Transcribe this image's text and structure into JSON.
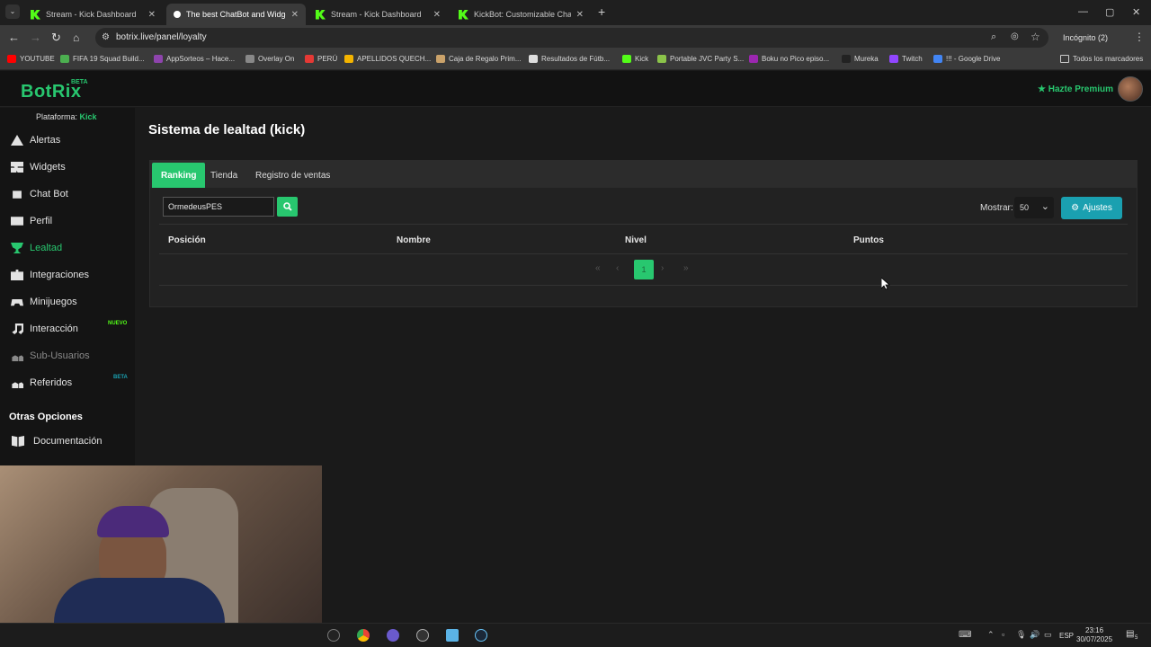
{
  "browser": {
    "tabs": [
      {
        "label": "Stream - Kick Dashboard",
        "active": false
      },
      {
        "label": "The best ChatBot and Widgets",
        "active": true
      },
      {
        "label": "Stream - Kick Dashboard",
        "active": false
      },
      {
        "label": "KickBot: Customizable Chat Bo",
        "active": false
      }
    ],
    "url": "botrix.live/panel/loyalty",
    "incognito_label": "Incógnito (2)",
    "bookmarks": [
      {
        "label": "YOUTUBE",
        "color": "#ff0000"
      },
      {
        "label": "FIFA 19 Squad Build...",
        "color": "#4caf50"
      },
      {
        "label": "AppSorteos – Hace...",
        "color": "#8e44ad"
      },
      {
        "label": "Overlay On",
        "color": "#888888"
      },
      {
        "label": "PERÚ",
        "color": "#e53935"
      },
      {
        "label": "APELLIDOS QUECH...",
        "color": "#f4b400"
      },
      {
        "label": "Caja de Regalo Prim...",
        "color": "#caa26a"
      },
      {
        "label": "Resultados de Fútb...",
        "color": "#dddddd"
      },
      {
        "label": "Kick",
        "color": "#53fc18"
      },
      {
        "label": "Portable JVC Party S...",
        "color": "#8bc34a"
      },
      {
        "label": "Boku no Pico episo...",
        "color": "#9c27b0"
      },
      {
        "label": "Mureka",
        "color": "#222222"
      },
      {
        "label": "Twitch",
        "color": "#9146ff"
      },
      {
        "label": "!!! - Google Drive",
        "color": "#4285f4"
      }
    ],
    "all_bookmarks_label": "Todos los marcadores"
  },
  "app": {
    "logo": "BotRix",
    "logo_badge": "BETA",
    "premium_label": "Hazte Premium",
    "accent": "#28c76f"
  },
  "sidebar": {
    "platform_label": "Plataforma:",
    "platform_value": "Kick",
    "items": [
      {
        "label": "Alertas",
        "icon": "warning-icon"
      },
      {
        "label": "Widgets",
        "icon": "grid-icon"
      },
      {
        "label": "Chat Bot",
        "icon": "robot-icon"
      },
      {
        "label": "Perfil",
        "icon": "id-card-icon"
      },
      {
        "label": "Lealtad",
        "icon": "trophy-icon"
      },
      {
        "label": "Integraciones",
        "icon": "puzzle-icon"
      },
      {
        "label": "Minijuegos",
        "icon": "gamepad-icon"
      },
      {
        "label": "Interacción",
        "icon": "music-icon",
        "tag": "NUEVO"
      },
      {
        "label": "Sub-Usuarios",
        "icon": "users-icon"
      },
      {
        "label": "Referidos",
        "icon": "users-icon",
        "tag": "BETA"
      }
    ],
    "section_label": "Otras Opciones",
    "other_items": [
      {
        "label": "Documentación",
        "icon": "book-icon"
      }
    ]
  },
  "main": {
    "title": "Sistema de lealtad (kick)",
    "tabs": [
      "Ranking",
      "Tienda",
      "Registro de ventas"
    ],
    "search_value": "OrmedeusPES",
    "show_label": "Mostrar:",
    "show_value": "50",
    "settings_label": "Ajustes",
    "columns": [
      "Posición",
      "Nombre",
      "Nivel",
      "Puntos"
    ],
    "pagination": {
      "current": "1"
    }
  },
  "taskbar": {
    "language": "ESP",
    "time": "23:16",
    "date": "30/07/2025",
    "notifications": "5"
  }
}
